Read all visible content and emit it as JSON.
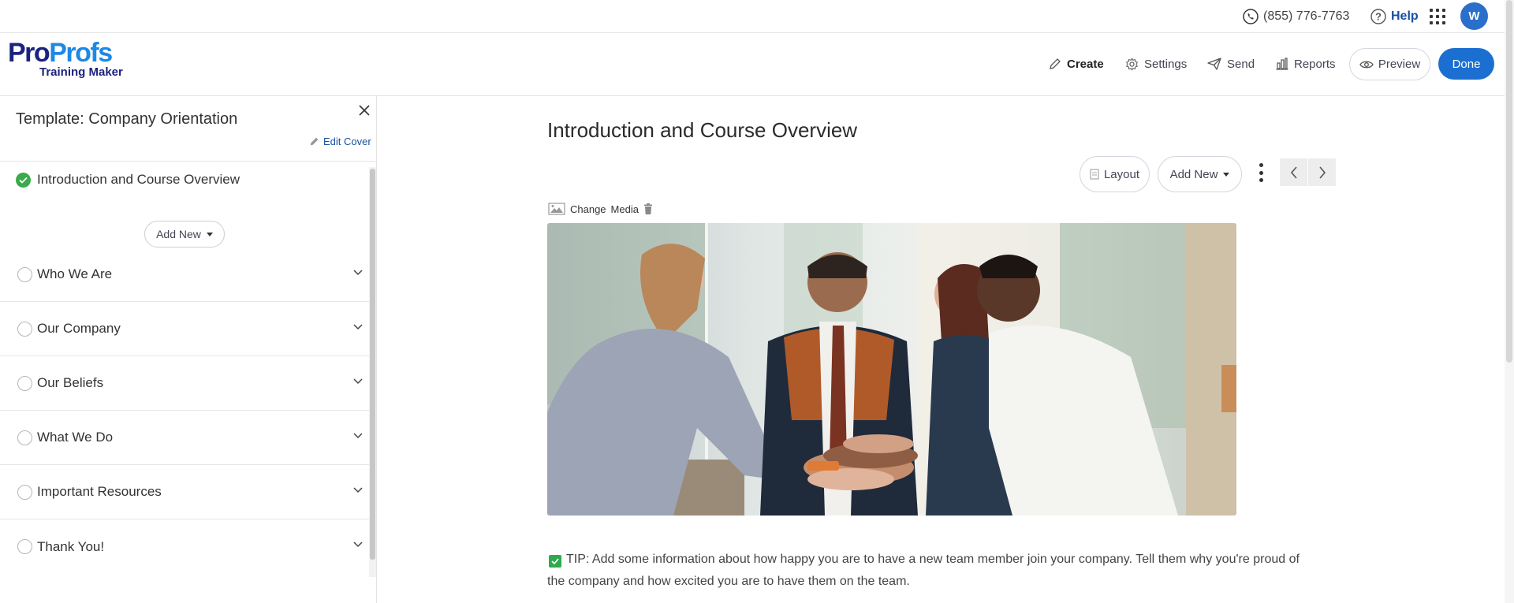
{
  "topbar": {
    "phone": "(855) 776-7763",
    "help": "Help",
    "avatar_initial": "W"
  },
  "header": {
    "logo_brand_a": "Pro",
    "logo_brand_b": "Profs",
    "logo_sub": "Training Maker",
    "nav": {
      "create": "Create",
      "settings": "Settings",
      "send": "Send",
      "reports": "Reports"
    },
    "preview": "Preview",
    "done": "Done"
  },
  "sidebar": {
    "template_title": "Template: Company Orientation",
    "edit_cover": "Edit Cover",
    "active_item": "Introduction and Course Overview",
    "add_new": "Add New",
    "items": [
      {
        "label": "Who We Are"
      },
      {
        "label": "Our Company"
      },
      {
        "label": "Our Beliefs"
      },
      {
        "label": "What We Do"
      },
      {
        "label": "Important Resources"
      },
      {
        "label": "Thank You!"
      }
    ]
  },
  "main": {
    "title": "Introduction and Course Overview",
    "layout_btn": "Layout",
    "add_new_btn": "Add New",
    "change_media_a": "Change",
    "change_media_b": "Media",
    "tip": "TIP: Add some information about how happy you are to have a new team member join your company. Tell them why you're proud of the company and how excited you are to have them on the team."
  },
  "colors": {
    "brand_dark": "#1a237e",
    "brand_light": "#1e88e5",
    "primary_button": "#1a6fd0",
    "success": "#3aaa4b"
  }
}
